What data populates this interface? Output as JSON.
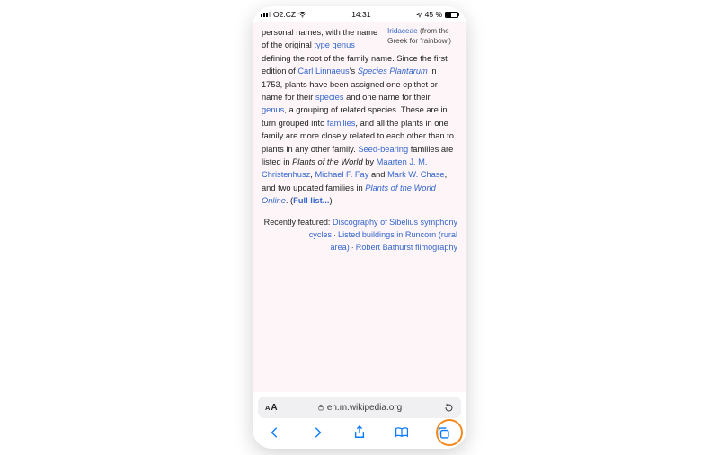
{
  "status_bar": {
    "carrier": "O2.CZ",
    "time": "14:31",
    "battery_percent": "45 %"
  },
  "sidebox": {
    "link": "Iridaceae",
    "rest": " (from the Greek for 'rainbow')"
  },
  "article": {
    "frag1": "personal names, with the name of the original ",
    "link_type": "type genus",
    "frag2": " defining the root of the family name. Since the first edition of ",
    "link_linnaeus": "Carl Linnaeus",
    "frag3": "'s ",
    "species_plantarum": "Species Plantarum",
    "frag4": " in 1753, plants have been assigned one epithet or name for their ",
    "link_species": "species",
    "frag5": " and one name for their ",
    "link_genus": "genus",
    "frag6": ", a grouping of related species. These are in turn grouped into ",
    "link_families": "families",
    "frag7": ", and all the plants in one family are more closely related to each other than to plants in any other family. ",
    "link_seed": "Seed-bearing",
    "frag8": " families are listed in ",
    "plants_world": "Plants of the World",
    "frag9": " by ",
    "link_christen": "Maarten J. M. Christenhusz",
    "comma": ", ",
    "link_fay": "Michael F. Fay",
    "and": " and ",
    "link_chase": "Mark W. Chase",
    "frag10": ", and two updated families in ",
    "plants_online": "Plants of the World Online",
    "frag11": ". (",
    "full_list": "Full list...",
    "frag12": ")"
  },
  "recent": {
    "label": "Recently featured: ",
    "link1": "Discography of Sibelius symphony cycles",
    "link2": "Listed buildings in Runcorn (rural area)",
    "link3": "Robert Bathurst filmography",
    "dot": "·"
  },
  "address_bar": {
    "domain": "en.m.wikipedia.org"
  }
}
